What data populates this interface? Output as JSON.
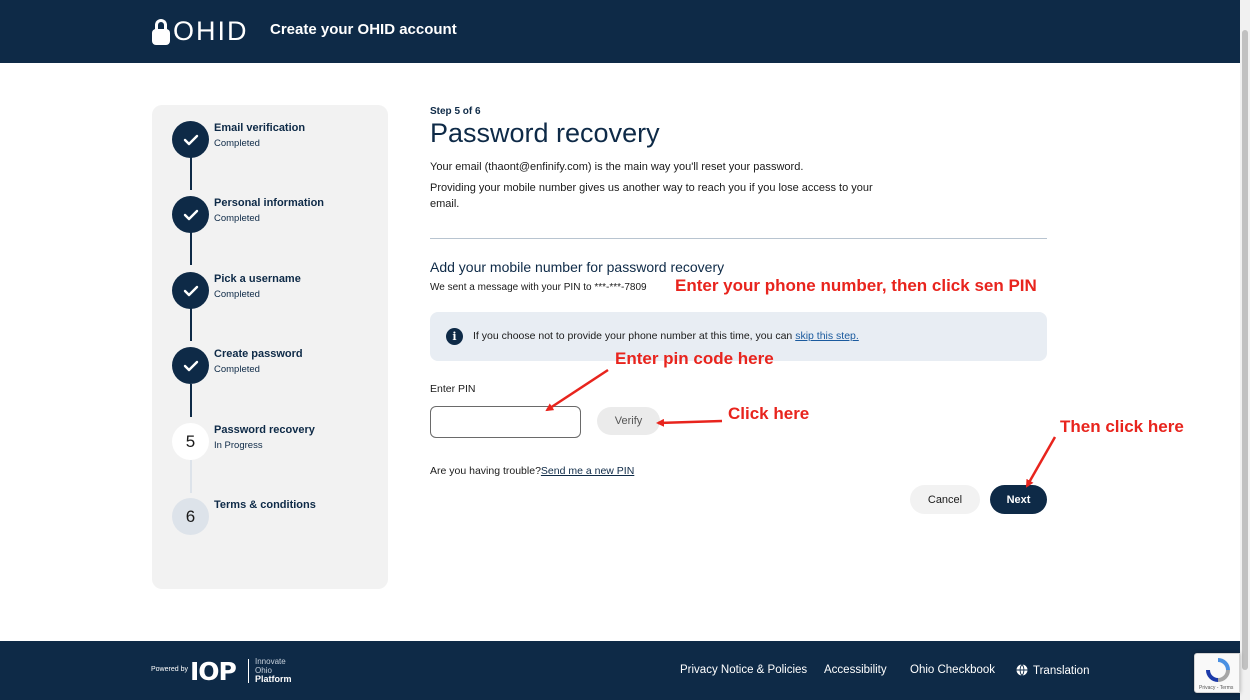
{
  "header": {
    "logo_text": "OHID",
    "title": "Create your OHID account"
  },
  "sidebar": {
    "steps": [
      {
        "label": "Email verification",
        "status": "Completed"
      },
      {
        "label": "Personal information",
        "status": "Completed"
      },
      {
        "label": "Pick a username",
        "status": "Completed"
      },
      {
        "label": "Create password",
        "status": "Completed"
      },
      {
        "number": "5",
        "label": "Password recovery",
        "status": "In Progress"
      },
      {
        "number": "6",
        "label": "Terms & conditions"
      }
    ]
  },
  "main": {
    "step_indicator": "Step 5 of 6",
    "title": "Password recovery",
    "intro_1": "Your email (thaont@enfinify.com) is the main way you'll reset your password.",
    "intro_2": "Providing your mobile number gives us another way to reach you if you lose access to your email.",
    "section_title": "Add your mobile number for password recovery",
    "sent_message": "We sent a message with your PIN to ***-***-7809",
    "info_text": "If you choose not to provide your phone number at this time, you can ",
    "info_link": "skip this step.",
    "pin_label": "Enter PIN",
    "pin_value": "",
    "verify_label": "Verify",
    "trouble_text": "Are you having trouble?",
    "trouble_link": "Send me a new PIN",
    "cancel_label": "Cancel",
    "next_label": "Next"
  },
  "annotations": {
    "phone": "Enter your phone number, then click sen PIN",
    "pin": "Enter pin code here",
    "verify": "Click here",
    "next": "Then click here",
    "color": "#e8241d"
  },
  "footer": {
    "powered_by": "Powered by",
    "brand": "IOP",
    "platform_lines": [
      "Innovate",
      "Ohio",
      "Platform"
    ],
    "links": [
      "Privacy Notice & Policies",
      "Accessibility",
      "Ohio Checkbook",
      "Translation"
    ]
  },
  "recaptcha": {
    "text": "Privacy - Terms"
  },
  "colors": {
    "navy": "#0e2a47",
    "link": "#1a5a9e",
    "annotation_red": "#e8241d"
  }
}
